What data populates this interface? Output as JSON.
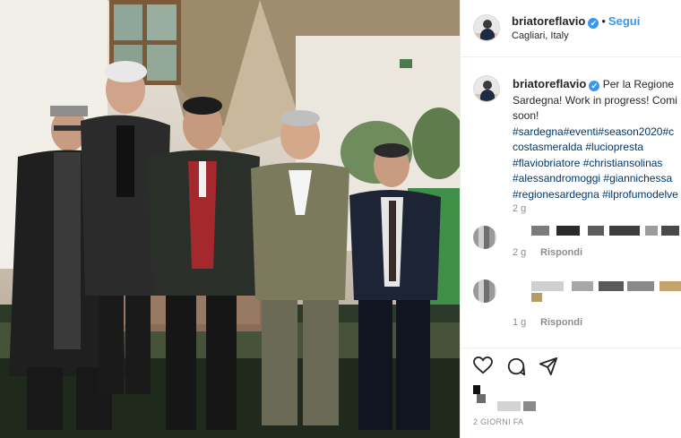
{
  "post": {
    "username": "briatoreflavio",
    "verified_glyph": "✔",
    "follow_label": "Segui",
    "separator": "•",
    "location": "Cagliari, Italy"
  },
  "caption": {
    "username": "briatoreflavio",
    "lines": [
      "Per la Regione",
      "Sardegna! Work in progress! Comi",
      "soon!"
    ],
    "hashtags": [
      "#sardegna#eventi#season2020#c",
      "costasmeralda #luciopresta",
      "#flaviobriatore #christiansolinas",
      "#alessandromoggi #giannichessa",
      "#regionesardegna #ilprofumodelve"
    ],
    "time": "2 g"
  },
  "comments": [
    {
      "time": "2 g",
      "reply_label": "Rispondi"
    },
    {
      "time": "1 g",
      "reply_label": "Rispondi"
    }
  ],
  "actions": {
    "like_icon": "heart-icon",
    "comment_icon": "comment-icon",
    "share_icon": "paper-plane-icon"
  },
  "footer": {
    "date": "2 GIORNI FA"
  },
  "colors": {
    "accent": "#3897f0",
    "hashtag": "#00376b",
    "muted": "#8e8e8e"
  }
}
